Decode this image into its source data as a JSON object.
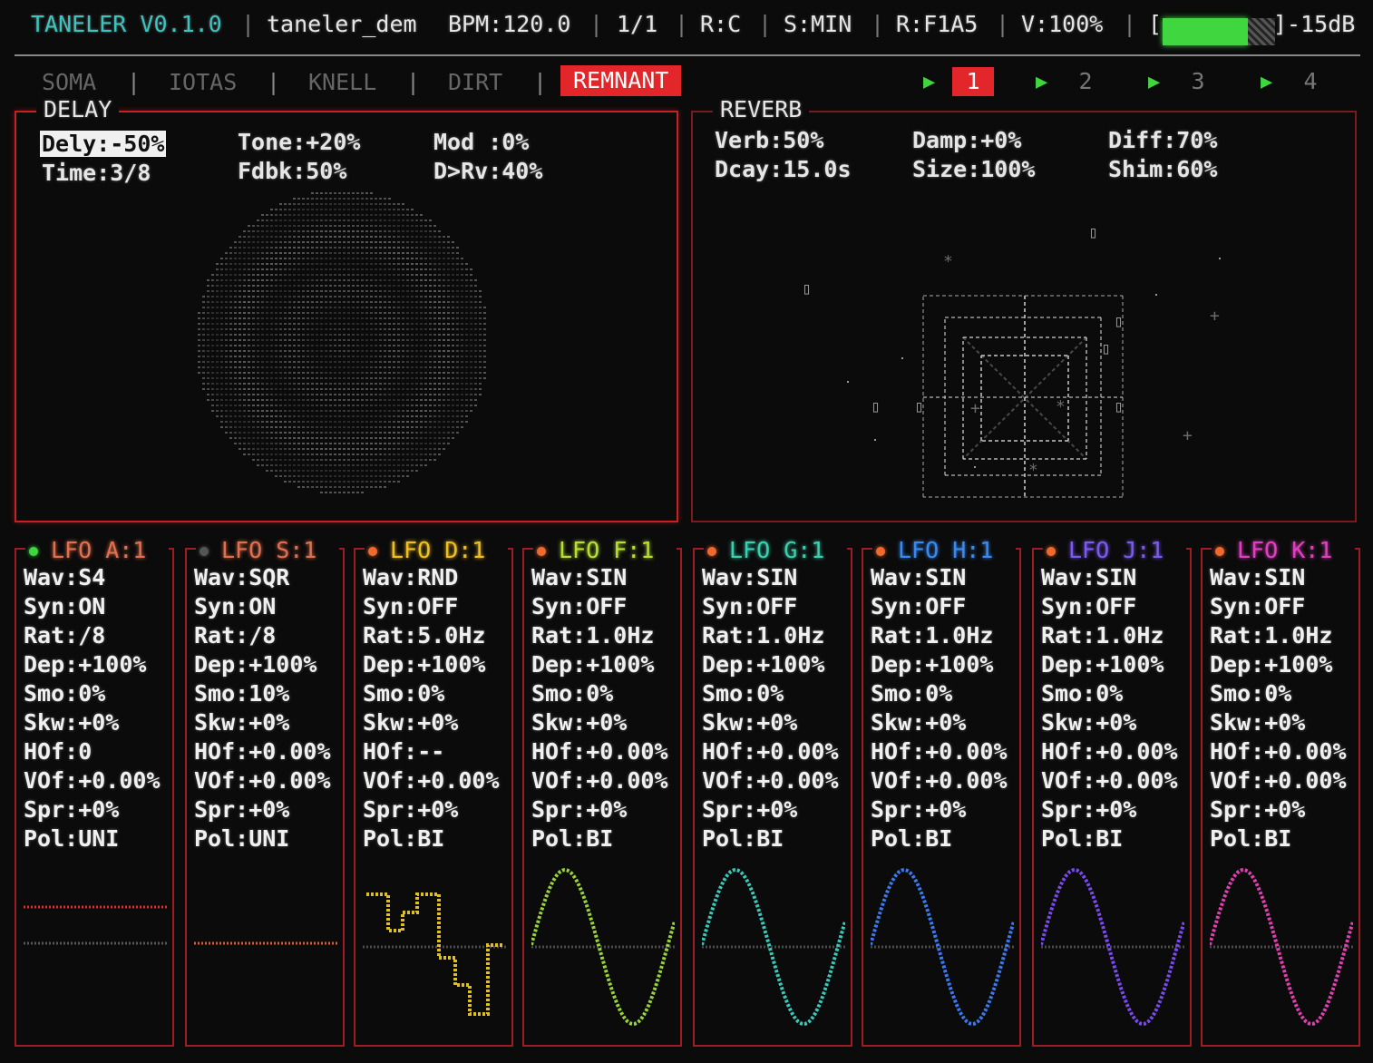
{
  "header": {
    "title": "TANELER V0.1.0",
    "project": "taneler_dem",
    "bpm": "BPM:120.0",
    "bar": "1/1",
    "root": "R:C",
    "scale": "S:MIN",
    "rand": "R:F1A5",
    "volume": "V:100%",
    "meter_open": "[",
    "meter_close": "]-15dB",
    "meter_level": 0.75,
    "separator": "|"
  },
  "tabs": [
    {
      "label": "SOMA",
      "active": false
    },
    {
      "label": "IOTAS",
      "active": false
    },
    {
      "label": "KNELL",
      "active": false
    },
    {
      "label": "DIRT",
      "active": false
    },
    {
      "label": "REMNANT",
      "active": true
    }
  ],
  "pages": [
    {
      "label": "1",
      "active": true
    },
    {
      "label": "2",
      "active": false
    },
    {
      "label": "3",
      "active": false
    },
    {
      "label": "4",
      "active": false
    }
  ],
  "play_glyph": "▶",
  "delay": {
    "title": "DELAY",
    "params": [
      "Dely:-50%",
      "Time:3/8",
      "Tone:+20%",
      "Fdbk:50%",
      "Mod :0%",
      "D>Rv:40%"
    ]
  },
  "reverb": {
    "title": "REVERB",
    "params": [
      "Verb:50%",
      "Dcay:15.0s",
      "Damp:+0%",
      "Size:100%",
      "Diff:70%",
      "Shim:60%"
    ]
  },
  "lfos": [
    {
      "title": "LFO A:1",
      "dot_color": "#3fd640",
      "title_color": "#e07050",
      "wave_color": "#e02a2a",
      "wave": "flat",
      "params": [
        "Wav:S4",
        "Syn:ON",
        "Rat:/8",
        "Dep:+100%",
        "Smo:0%",
        "Skw:+0%",
        "HOf:0",
        "VOf:+0.00%",
        "Spr:+0%",
        "Pol:UNI"
      ]
    },
    {
      "title": "LFO S:1",
      "dot_color": "#555555",
      "title_color": "#e07050",
      "wave_color": "#e05a2a",
      "wave": "flat",
      "params": [
        "Wav:SQR",
        "Syn:ON",
        "Rat:/8",
        "Dep:+100%",
        "Smo:10%",
        "Skw:+0%",
        "HOf:+0.00%",
        "VOf:+0.00%",
        "Spr:+0%",
        "Pol:UNI"
      ]
    },
    {
      "title": "LFO D:1",
      "dot_color": "#f06a30",
      "title_color": "#f0c020",
      "wave_color": "#e0c020",
      "wave": "rnd",
      "params": [
        "Wav:RND",
        "Syn:OFF",
        "Rat:5.0Hz",
        "Dep:+100%",
        "Smo:0%",
        "Skw:+0%",
        "HOf:--",
        "VOf:+0.00%",
        "Spr:+0%",
        "Pol:BI"
      ]
    },
    {
      "title": "LFO F:1",
      "dot_color": "#f06a30",
      "title_color": "#b8e030",
      "wave_color": "#9ad23a",
      "wave": "sin",
      "params": [
        "Wav:SIN",
        "Syn:OFF",
        "Rat:1.0Hz",
        "Dep:+100%",
        "Smo:0%",
        "Skw:+0%",
        "HOf:+0.00%",
        "VOf:+0.00%",
        "Spr:+0%",
        "Pol:BI"
      ]
    },
    {
      "title": "LFO G:1",
      "dot_color": "#f06a30",
      "title_color": "#3ad0b0",
      "wave_color": "#3ac8b8",
      "wave": "sin",
      "params": [
        "Wav:SIN",
        "Syn:OFF",
        "Rat:1.0Hz",
        "Dep:+100%",
        "Smo:0%",
        "Skw:+0%",
        "HOf:+0.00%",
        "VOf:+0.00%",
        "Spr:+0%",
        "Pol:BI"
      ]
    },
    {
      "title": "LFO H:1",
      "dot_color": "#f06a30",
      "title_color": "#3a8af0",
      "wave_color": "#3a7af0",
      "wave": "sin",
      "params": [
        "Wav:SIN",
        "Syn:OFF",
        "Rat:1.0Hz",
        "Dep:+100%",
        "Smo:0%",
        "Skw:+0%",
        "HOf:+0.00%",
        "VOf:+0.00%",
        "Spr:+0%",
        "Pol:BI"
      ]
    },
    {
      "title": "LFO J:1",
      "dot_color": "#f06a30",
      "title_color": "#7a5af0",
      "wave_color": "#7a4af0",
      "wave": "sin",
      "params": [
        "Wav:SIN",
        "Syn:OFF",
        "Rat:1.0Hz",
        "Dep:+100%",
        "Smo:0%",
        "Skw:+0%",
        "HOf:+0.00%",
        "VOf:+0.00%",
        "Spr:+0%",
        "Pol:BI"
      ]
    },
    {
      "title": "LFO K:1",
      "dot_color": "#f06a30",
      "title_color": "#e040c0",
      "wave_color": "#e040b0",
      "wave": "sin",
      "params": [
        "Wav:SIN",
        "Syn:OFF",
        "Rat:1.0Hz",
        "Dep:+100%",
        "Smo:0%",
        "Skw:+0%",
        "HOf:+0.00%",
        "VOf:+0.00%",
        "Spr:+0%",
        "Pol:BI"
      ]
    }
  ]
}
